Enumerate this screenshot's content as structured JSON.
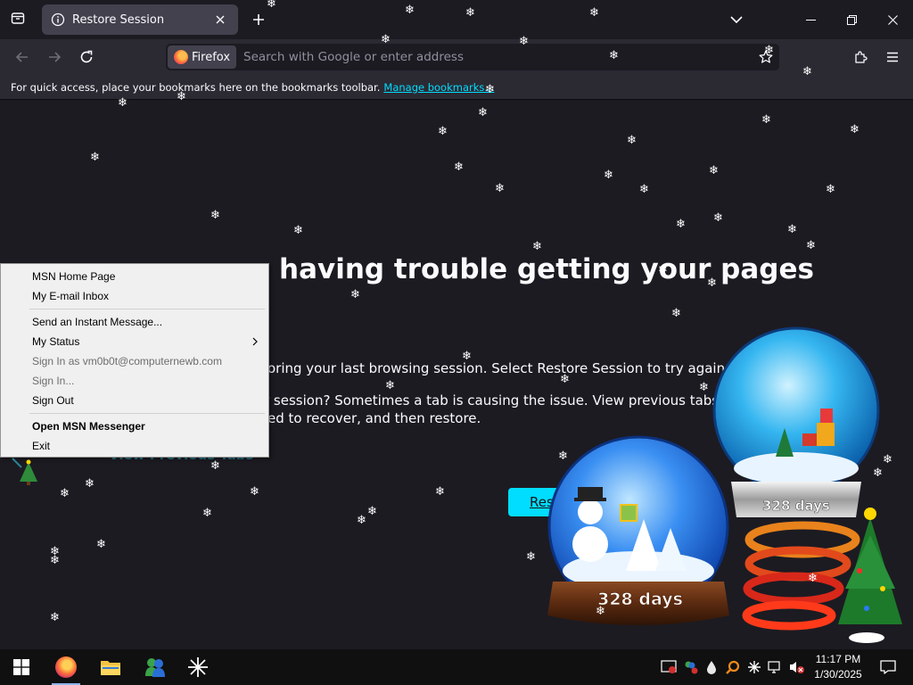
{
  "browser": {
    "tab": {
      "title": "Restore Session"
    },
    "urlbar": {
      "identity_label": "Firefox",
      "placeholder": "Search with Google or enter address"
    },
    "bookmarks_bar": {
      "message": "For quick access, place your bookmarks here on the bookmarks toolbar.",
      "link": "Manage bookmarks..."
    }
  },
  "page": {
    "title_visible": "having trouble getting your pages",
    "paragraph1_visible": "oring your last browsing session. Select Restore Session to try again.",
    "paragraph2_line1_visible": "r session? Sometimes a tab is causing the issue. View previous tabs, remove",
    "paragraph2_line2_visible": "ed to recover, and then restore.",
    "link_visible": "View Previous Tabs",
    "restore_button_visible": "Res"
  },
  "context_menu": {
    "items": [
      {
        "label": "MSN Home Page",
        "state": "enabled"
      },
      {
        "label": "My E-mail Inbox",
        "state": "enabled"
      },
      {
        "label": "Send an Instant Message...",
        "state": "enabled"
      },
      {
        "label": "My Status",
        "state": "enabled",
        "submenu": true
      },
      {
        "label": "Sign In as vm0b0t@computernewb.com",
        "state": "disabled"
      },
      {
        "label": "Sign In...",
        "state": "disabled"
      },
      {
        "label": "Sign Out",
        "state": "enabled"
      },
      {
        "label": "Open MSN Messenger",
        "state": "enabled",
        "bold": true
      },
      {
        "label": "Exit",
        "state": "enabled"
      }
    ]
  },
  "decorations": {
    "globe_left_label": "328 days",
    "globe_right_label": "328 days"
  },
  "taskbar": {
    "clock_time": "11:17 PM",
    "clock_date": "1/30/2025"
  },
  "colors": {
    "page_bg": "#1c1b22",
    "toolbar_bg": "#2b2a33",
    "accent": "#00ddff",
    "menu_bg": "#f0f0f0",
    "taskbar_bg": "#101010"
  }
}
